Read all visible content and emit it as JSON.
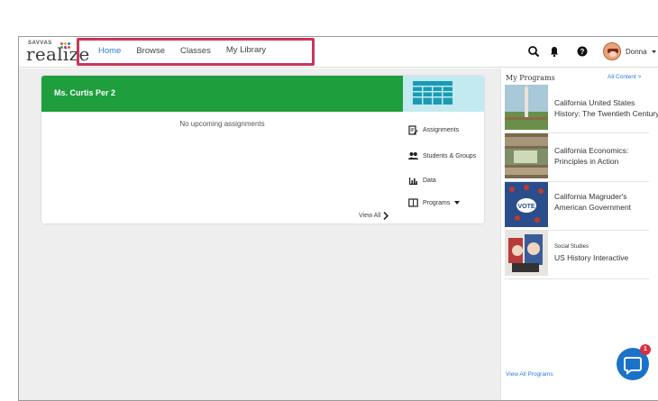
{
  "brand": {
    "small": "SAVVAS",
    "name": "realize"
  },
  "nav": {
    "items": [
      {
        "label": "Home",
        "active": true
      },
      {
        "label": "Browse",
        "active": false
      },
      {
        "label": "Classes",
        "active": false
      },
      {
        "label": "My Library",
        "active": false
      }
    ]
  },
  "header": {
    "icons": [
      "search-icon",
      "bell-icon",
      "help-icon"
    ],
    "user_name": "Donna"
  },
  "class_card": {
    "title": "Ms. Curtis Per 2",
    "empty_message": "No upcoming assignments",
    "links": [
      {
        "label": "Assignments",
        "icon": "assignments-icon"
      },
      {
        "label": "Students & Groups",
        "icon": "users-icon"
      },
      {
        "label": "Data",
        "icon": "bar-chart-icon"
      },
      {
        "label": "Programs",
        "icon": "book-icon"
      }
    ],
    "view_all": "View All"
  },
  "sidebar": {
    "title": "My Programs",
    "all_content": "All Content >",
    "programs": [
      {
        "subtitle": "",
        "title_lines": [
          "California United States",
          "History: The Twentieth Century"
        ]
      },
      {
        "subtitle": "",
        "title_lines": [
          "California Economics:",
          "Principles in Action"
        ]
      },
      {
        "subtitle": "",
        "title_lines": [
          "California Magruder's",
          "American Government"
        ]
      },
      {
        "subtitle": "Social Studies",
        "title_lines": [
          "US History Interactive"
        ]
      }
    ],
    "view_all": "View All Programs"
  },
  "chat": {
    "badge": "1"
  },
  "colors": {
    "accent": "#2e7bd6",
    "card_green": "#1e9e3c",
    "highlight": "#c8375a",
    "chat": "#1a73c9"
  }
}
